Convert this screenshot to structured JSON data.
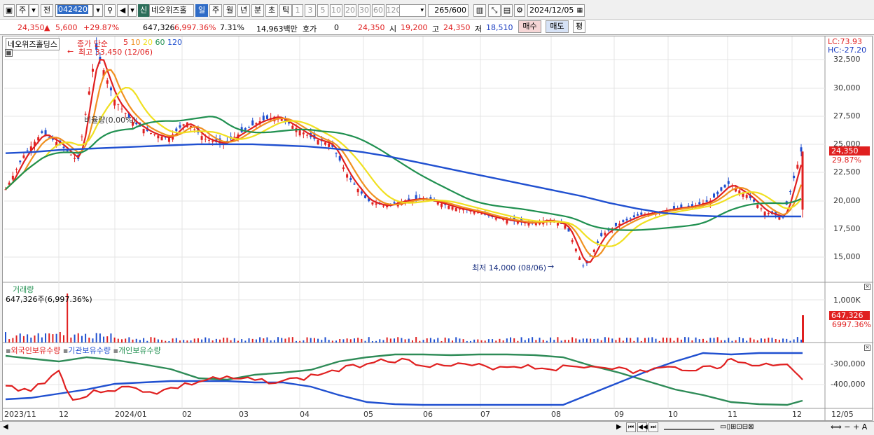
{
  "toolbar": {
    "period_label": "주",
    "prev_label": "전",
    "stock_code": "042420",
    "stock_badge": "신",
    "stock_name": "네오위즈홀",
    "periods": [
      "일",
      "주",
      "월",
      "년",
      "분",
      "초",
      "틱"
    ],
    "active_period": "일",
    "intervals": [
      "1",
      "3",
      "5",
      "10",
      "20",
      "30",
      "60",
      "120"
    ],
    "count_value": "265",
    "count_total": "/600",
    "date_value": "2024/12/05"
  },
  "quote": {
    "price": "24,350",
    "arrow": "▲",
    "change": "5,600",
    "change_pct": "+29.87%",
    "volume": "647,326",
    "volume_pct": "6,997.36%",
    "turnover_pct": "7.31%",
    "amount": "14,963백만",
    "hoga_label": "호가",
    "hoga_value": "0",
    "close": "24,350",
    "open_label": "시",
    "open": "19,200",
    "high_label": "고",
    "high": "24,350",
    "low_label": "저",
    "low": "18,510",
    "buy_label": "매수",
    "sell_label": "매도",
    "avg_label": "평"
  },
  "price_panel": {
    "stock_name_tag": "네오위즈홀딩스",
    "ma_title": "종가 단순",
    "ma_periods": [
      "5",
      "10",
      "20",
      "60",
      "120"
    ],
    "ma_colors": [
      "#e02020",
      "#f09020",
      "#f0e020",
      "#209050",
      "#2050d0"
    ],
    "lc_label": "LC:73.93",
    "hc_label": "HC:-27.20",
    "high_annot": "최고 33,450 (12/06)",
    "low_annot": "최저 14,000 (08/06)",
    "ratio_annot": "비율량(0.00%)",
    "price_tag": "24,350",
    "pct_tag": "29.87%",
    "y_ticks": [
      "32,500",
      "30,000",
      "27,500",
      "25,000",
      "22,500",
      "20,000",
      "17,500",
      "15,000"
    ]
  },
  "volume_panel": {
    "title": "거래량",
    "value_label": "647,326주(6,997.36%)",
    "y_tick": "1,000K",
    "tag_value": "647,326",
    "tag_pct": "6997.36%"
  },
  "holdings_panel": {
    "series": [
      "외국인보유수량",
      "기관보유수량",
      "개인보유수량"
    ],
    "series_colors": [
      "#e02020",
      "#2050d0",
      "#209050"
    ],
    "y_ticks": [
      "-300,000",
      "-400,000"
    ]
  },
  "x_axis": [
    "2023/11",
    "12",
    "2024/01",
    "02",
    "03",
    "04",
    "05",
    "06",
    "07",
    "08",
    "09",
    "10",
    "11",
    "12",
    "12/05"
  ],
  "chart_data": {
    "type": "line",
    "title": "",
    "ylim": [
      13000,
      34000
    ],
    "series": [
      {
        "name": "종가",
        "values": [
          21000,
          24000,
          26000,
          25000,
          23500,
          33450,
          29000,
          27000,
          26000,
          25500,
          27000,
          25500,
          25000,
          26000,
          27000,
          27500,
          26500,
          25500,
          25000,
          22000,
          20000,
          19500,
          20000,
          20200,
          19800,
          19300,
          19000,
          18500,
          18200,
          18000,
          18300,
          17800,
          14000,
          17000,
          18000,
          18700,
          19000,
          19300,
          19500,
          20000,
          21500,
          20500,
          19000,
          18500,
          24350
        ]
      },
      {
        "name": "120",
        "values": [
          24200,
          24300,
          24500,
          24600,
          24700,
          24800,
          24900,
          25000,
          25000,
          25000,
          24900,
          24800,
          24600,
          24300,
          23900,
          23400,
          22900,
          22400,
          21900,
          21400,
          20900,
          20400,
          19800,
          19300,
          18900,
          18700,
          18600,
          18600,
          18600,
          18600
        ]
      }
    ]
  }
}
